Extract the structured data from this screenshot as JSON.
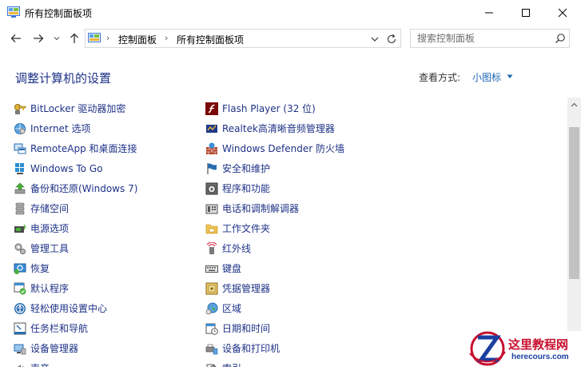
{
  "window": {
    "title": "所有控制面板项"
  },
  "address": {
    "crumbs": [
      "控制面板",
      "所有控制面板项"
    ]
  },
  "search": {
    "placeholder": "搜索控制面板"
  },
  "header": {
    "heading": "调整计算机的设置",
    "view_by_label": "查看方式:",
    "view_by_value": "小图标"
  },
  "items_left": [
    {
      "label": "BitLocker 驱动器加密",
      "icon": "bitlocker-icon"
    },
    {
      "label": "Internet 选项",
      "icon": "internet-options-icon"
    },
    {
      "label": "RemoteApp 和桌面连接",
      "icon": "remoteapp-icon"
    },
    {
      "label": "Windows To Go",
      "icon": "windows-to-go-icon"
    },
    {
      "label": "备份和还原(Windows 7)",
      "icon": "backup-restore-icon"
    },
    {
      "label": "存储空间",
      "icon": "storage-spaces-icon"
    },
    {
      "label": "电源选项",
      "icon": "power-options-icon"
    },
    {
      "label": "管理工具",
      "icon": "admin-tools-icon"
    },
    {
      "label": "恢复",
      "icon": "recovery-icon"
    },
    {
      "label": "默认程序",
      "icon": "default-programs-icon"
    },
    {
      "label": "轻松使用设置中心",
      "icon": "ease-of-access-icon"
    },
    {
      "label": "任务栏和导航",
      "icon": "taskbar-icon"
    },
    {
      "label": "设备管理器",
      "icon": "device-manager-icon"
    },
    {
      "label": "声音",
      "icon": "sound-icon"
    }
  ],
  "items_right": [
    {
      "label": "Flash Player (32 位)",
      "icon": "flash-player-icon"
    },
    {
      "label": "Realtek高清晰音频管理器",
      "icon": "realtek-audio-icon"
    },
    {
      "label": "Windows Defender 防火墙",
      "icon": "firewall-icon"
    },
    {
      "label": "安全和维护",
      "icon": "security-maintenance-icon"
    },
    {
      "label": "程序和功能",
      "icon": "programs-features-icon"
    },
    {
      "label": "电话和调制解调器",
      "icon": "phone-modem-icon"
    },
    {
      "label": "工作文件夹",
      "icon": "work-folders-icon"
    },
    {
      "label": "红外线",
      "icon": "infrared-icon"
    },
    {
      "label": "键盘",
      "icon": "keyboard-icon"
    },
    {
      "label": "凭据管理器",
      "icon": "credential-manager-icon"
    },
    {
      "label": "区域",
      "icon": "region-icon"
    },
    {
      "label": "日期和时间",
      "icon": "date-time-icon"
    },
    {
      "label": "设备和打印机",
      "icon": "devices-printers-icon"
    },
    {
      "label": "索引",
      "icon": "indexing-icon"
    }
  ],
  "watermark": {
    "text": "这里教程网",
    "url": "herecours.com"
  },
  "colors": {
    "link": "#1e3287",
    "accent": "#1a66b3"
  }
}
